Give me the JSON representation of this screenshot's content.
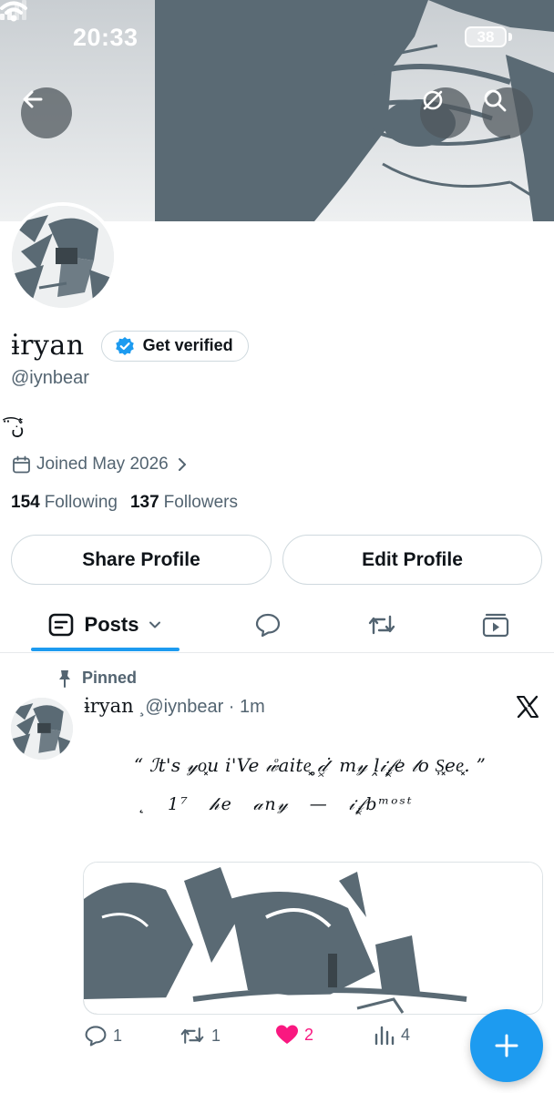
{
  "status_bar": {
    "time": "20:33",
    "battery": "38"
  },
  "header": {
    "back_icon": "arrow-left-icon",
    "premium_icon": "slashed-circle-icon",
    "search_icon": "search-icon"
  },
  "profile": {
    "display_name": "ɨ̇ryan",
    "get_verified_label": "Get verified",
    "handle": "@iynbear",
    "bio": "ن̈͡ ͑̾",
    "joined": "Joined May 2026",
    "following_count": "154",
    "following_label": "Following",
    "followers_count": "137",
    "followers_label": "Followers",
    "share_label": "Share Profile",
    "edit_label": "Edit Profile"
  },
  "tabs": {
    "posts_label": "Posts",
    "icons": [
      "posts-icon",
      "replies-icon",
      "reposts-icon",
      "media-icon"
    ]
  },
  "pinned_post": {
    "pinned_label": "Pinned",
    "author": "ɨ̇ryan",
    "handle_time": "¸@iynbear · 1m",
    "line1": "“ ℐt's 𝓎o͓u i'Ve 𝓌ͦaite͓ ̥𝒹͓ ̇ m𝓎 ḽ𝒾𝒻͓e 𝓉o Ș͓ee͓. ”",
    "line2": "˛ 1⁷ 𝒽e 𝒶n𝓎 — 𝒾𝒻͓bᵐᵒˢᵗ",
    "reply_count": "1",
    "repost_count": "1",
    "like_count": "2",
    "view_count": "4"
  },
  "colors": {
    "accent": "#1d9bf0",
    "like": "#f91880",
    "muted_text": "#536471",
    "border": "#cfd9de",
    "banner_ink": "#5a6a74"
  }
}
